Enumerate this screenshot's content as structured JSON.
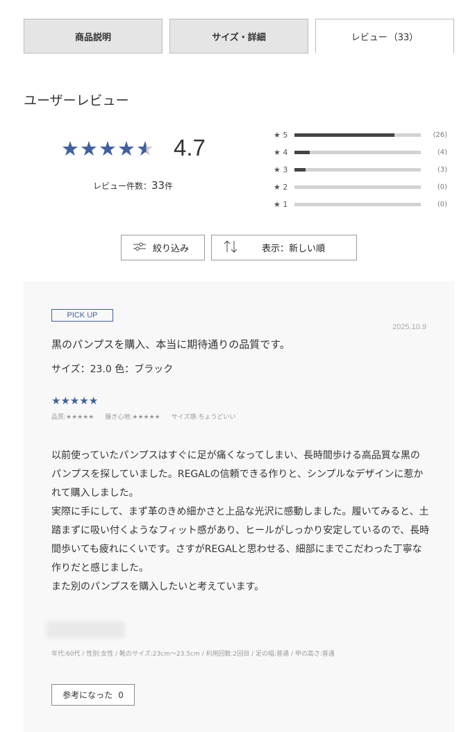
{
  "tabs": {
    "description": "商品説明",
    "size_detail": "サイズ・詳細",
    "reviews": "レビュー",
    "reviews_count": "（33）"
  },
  "section_title": "ユーザーレビュー",
  "summary": {
    "average": "4.7",
    "average_value": 4.7,
    "review_count_label": "レビュー件数：",
    "review_count": "33",
    "review_count_unit": "件",
    "distribution": [
      {
        "label": "★ 5",
        "count": "(26)",
        "fraction": 0.79
      },
      {
        "label": "★ 4",
        "count": "(4)",
        "fraction": 0.12
      },
      {
        "label": "★ 3",
        "count": "(3)",
        "fraction": 0.09
      },
      {
        "label": "★ 2",
        "count": "(0)",
        "fraction": 0
      },
      {
        "label": "★ 1",
        "count": "(0)",
        "fraction": 0
      }
    ]
  },
  "controls": {
    "filter_label": "絞り込み",
    "sort_label": "表示：新しい順"
  },
  "review": {
    "badge": "PICK UP",
    "date": "2025.10.9",
    "title": "黒のパンプスを購入、本当に期待通りの品質です。",
    "size_color": "サイズ：23.0 色：ブラック",
    "rating": 5,
    "attr_quality": "品質:★★★★★",
    "attr_comfort": "履き心地:★★★★★",
    "attr_size": "サイズ感:ちょうどいい",
    "body": [
      "以前使っていたパンプスはすぐに足が痛くなってしまい、長時間歩ける高品質な黒のパンプスを探していました。REGALの信頼できる作りと、シンプルなデザインに惹かれて購入しました。",
      "実際に手にして、まず革のきめ細かさと上品な光沢に感動しました。履いてみると、土踏まずに吸い付くようなフィット感があり、ヒールがしっかり安定しているので、長時間歩いても疲れにくいです。さすがREGALと思わせる、細部にまでこだわった丁寧な作りだと感じました。",
      "また別のパンプスを購入したいと考えています。"
    ],
    "meta": "年代:60代 / 性別:女性 / 靴のサイズ:23cm〜23.5cm / 利用回数:2回目 / 足の幅:普通 / 甲の高さ:普通",
    "helpful_label": "参考になった",
    "helpful_count": "0"
  },
  "colors": {
    "star": "#3f5f9f",
    "bar_fill": "#444444",
    "bar_track": "#d2d2d2",
    "card_bg": "#f8f8f8"
  },
  "icons": {
    "filter": "sliders-icon",
    "sort": "sort-arrows-icon",
    "star": "star-icon"
  }
}
